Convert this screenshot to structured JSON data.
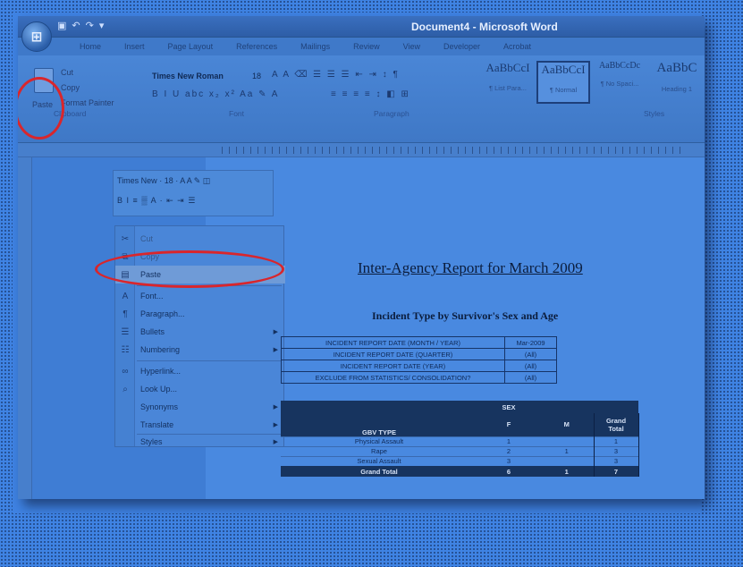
{
  "window": {
    "title": "Document4 - Microsoft Word",
    "office_button": "⊞"
  },
  "quick_access": [
    "▣",
    "↶",
    "↷",
    "▾"
  ],
  "ribbon": {
    "tabs": [
      "Home",
      "Insert",
      "Page Layout",
      "References",
      "Mailings",
      "Review",
      "View",
      "Developer",
      "Acrobat"
    ],
    "clipboard": {
      "paste": "Paste",
      "cut": "Cut",
      "copy": "Copy",
      "format_painter": "Format Painter",
      "group_label": "Clipboard"
    },
    "font": {
      "name": "Times New Roman",
      "size": "18",
      "group_label": "Font"
    },
    "paragraph_group_label": "Paragraph",
    "styles": {
      "group_label": "Styles",
      "items": [
        {
          "sample": "AaBbCcI",
          "name": "¶ List Para..."
        },
        {
          "sample": "AaBbCcI",
          "name": "¶ Normal"
        },
        {
          "sample": "AaBbCcDc",
          "name": "¶ No Spaci..."
        },
        {
          "sample": "AaBbC",
          "name": "Heading 1"
        }
      ]
    }
  },
  "mini_toolbar": {
    "font": "Times New",
    "size": "18",
    "row2": "B  I  ≡  ▒  A  ·  ⇤  ⇥  ☰"
  },
  "context_menu": [
    {
      "icon": "✂",
      "label": "Cut",
      "state": "dim"
    },
    {
      "icon": "⧉",
      "label": "Copy",
      "state": "dim"
    },
    {
      "icon": "▤",
      "label": "Paste",
      "state": "highlight"
    },
    {
      "icon": "A",
      "label": "Font...",
      "state": "normal"
    },
    {
      "icon": "¶",
      "label": "Paragraph...",
      "state": "normal"
    },
    {
      "icon": "☰",
      "label": "Bullets",
      "state": "submenu"
    },
    {
      "icon": "☷",
      "label": "Numbering",
      "state": "submenu"
    },
    {
      "icon": "∞",
      "label": "Hyperlink...",
      "state": "normal"
    },
    {
      "icon": "⌕",
      "label": "Look Up...",
      "state": "normal"
    },
    {
      "icon": "",
      "label": "Synonyms",
      "state": "submenu"
    },
    {
      "icon": "",
      "label": "Translate",
      "state": "submenu"
    },
    {
      "icon": "",
      "label": "Styles",
      "state": "submenu"
    }
  ],
  "document": {
    "heading": "Inter-Agency Report for March 2009",
    "subheading": "Incident Type by Survivor's Sex and Age",
    "filters": [
      {
        "key": "INCIDENT REPORT DATE (MONTH / YEAR)",
        "value": "Mar-2009"
      },
      {
        "key": "INCIDENT REPORT DATE (QUARTER)",
        "value": "(All)"
      },
      {
        "key": "INCIDENT REPORT DATE (YEAR)",
        "value": "(All)"
      },
      {
        "key": "EXCLUDE FROM STATISTICS/ CONSOLIDATION?",
        "value": "(All)"
      }
    ],
    "pivot": {
      "sex_label": "SEX",
      "row_header": "GBV TYPE",
      "cols": [
        "F",
        "M",
        "Grand Total"
      ],
      "rows": [
        {
          "type": "Physical Assault",
          "f": "1",
          "m": "",
          "total": "1"
        },
        {
          "type": "Rape",
          "f": "2",
          "m": "1",
          "total": "3"
        },
        {
          "type": "Sexual Assault",
          "f": "3",
          "m": "",
          "total": "3"
        }
      ],
      "total_row": {
        "type": "Grand Total",
        "f": "6",
        "m": "1",
        "total": "7"
      }
    }
  },
  "colors": {
    "annotation": "#d9262c",
    "background": "#3f83e3"
  }
}
